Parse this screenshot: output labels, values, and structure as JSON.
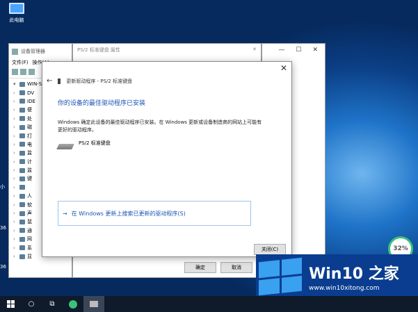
{
  "desktop": {
    "icon_label": "此电脑",
    "left_labels": [
      "小",
      "36",
      "36"
    ]
  },
  "device_manager": {
    "title": "设备管理器",
    "menu": [
      "文件(F)",
      "操作(A)"
    ],
    "tree_root": "WIN-S",
    "tree_items": [
      "DV",
      "IDE",
      "便",
      "处",
      "磁",
      "打",
      "电",
      "监",
      "计",
      "监",
      "键",
      "",
      "人",
      "软",
      "声",
      "鼠",
      "通",
      "网",
      "系",
      "显"
    ]
  },
  "properties_dialog": {
    "title": "PS/2 标准键盘 属性",
    "ok_label": "确定",
    "cancel_label": "取消"
  },
  "update_dialog": {
    "header": "更新驱动程序 - PS/2 标准键盘",
    "heading": "你的设备的最佳驱动程序已安装",
    "description": "Windows 确定此设备的最佳驱动程序已安装。在 Windows 更新或设备制造商的网站上可能有更好的驱动程序。",
    "device_name": "PS/2 标准键盘",
    "link_text": "在 Windows 更新上搜索已更新的驱动程序(S)",
    "close_label": "关闭(C)"
  },
  "security_badge": {
    "percent": "32%"
  },
  "watermark": {
    "brand": "Win10 之家",
    "url": "www.win10xitong.com"
  },
  "colors": {
    "accent": "#1a55b5",
    "taskbar": "#0f1a2a",
    "badge_ring": "#3cc07a"
  }
}
